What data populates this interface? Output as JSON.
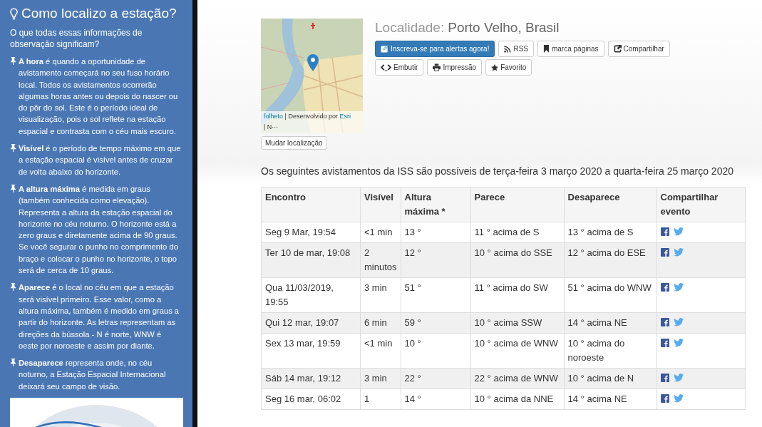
{
  "sidebar": {
    "title": "Como localizo a estação?",
    "intro": "O que todas essas informações de observação significam?",
    "items": [
      {
        "text": "**A hora**  é quando a oportunidade de avistamento começará no seu fuso horário local. Todos os avistamentos ocorrerão algumas horas antes ou depois do nascer ou do pôr do sol. Este é o período ideal de visualização, pois o sol reflete na estação espacial e contrasta com o céu mais escuro."
      },
      {
        "text": "**Visível**  é o período de tempo máximo em que a estação espacial é visível antes de cruzar de volta abaixo do horizonte."
      },
      {
        "text": "**A altura máxima**  é medida em graus (também conhecida como elevação). Representa a altura da estação espacial do horizonte no céu noturno. O horizonte está a zero graus e diretamente acima de 90 graus. Se você segurar o punho no comprimento do braço e colocar o punho no horizonte, o topo será de cerca de 10 graus."
      },
      {
        "text": "**Aparece** é o local no céu em que a estação será visível primeiro. Esse valor, como a altura máxima, também é medido em graus a partir do horizonte. As letras representam as direções da bússola - N é norte, WNW é oeste por noroeste e assim por diante."
      },
      {
        "text": "**Desaparece** representa onde, no céu noturno, a Estação Espacial Internacional deixará seu campo de visão."
      }
    ]
  },
  "map": {
    "attribution_link": "folheto",
    "attribution_text": "| Desenvolvido por",
    "provider_link": "Esri",
    "attribution_more": "| N···",
    "change_button": "Mudar localização"
  },
  "location": {
    "label": "Localidade:",
    "value": "Porto Velho, Brasil"
  },
  "buttons": [
    {
      "kind": "subscribe",
      "label": "Inscreva-se para alertas agora!"
    },
    {
      "kind": "rss",
      "label": "RSS"
    },
    {
      "kind": "bookmark",
      "label": "marca páginas"
    },
    {
      "kind": "share",
      "label": "Compartilhar"
    },
    {
      "kind": "embed",
      "label": "Embutir"
    },
    {
      "kind": "print",
      "label": "Impressão"
    },
    {
      "kind": "favorite",
      "label": "Favorito"
    }
  ],
  "summary": "Os seguintes avistamentos da ISS são possíveis de terça-feira 3 março 2020 a quarta-feira 25 março 2020",
  "table": {
    "columns": [
      "Encontro",
      "Visível",
      "Altura máxima *",
      "Parece",
      "Desaparece",
      "Compartilhar evento"
    ],
    "rows": [
      [
        "Seg 9 Mar, 19:54",
        "<1 min",
        "13 °",
        "11 ° acima de S",
        "13 ° acima de S"
      ],
      [
        "Ter 10 de mar, 19:08",
        "2 minutos",
        "12 °",
        "10 ° acima do SSE",
        "12 ° acima do ESE"
      ],
      [
        "Qua 11/03/2019, 19:55",
        "3 min",
        "51 °",
        "11 ° acima do SW",
        "51 ° acima do WNW"
      ],
      [
        "Qui 12 mar, 19:07",
        "6 min",
        "59 °",
        "10 ° acima SSW",
        "14 ° acima NE"
      ],
      [
        "Sex 13 mar, 19:59",
        "<1 min",
        "10 °",
        "10 ° acima de WNW",
        "10 ° acima do noroeste"
      ],
      [
        "Sáb 14 mar, 19:12",
        "3 min",
        "22 °",
        "22 ° acima de WNW",
        "10 ° acima de N"
      ],
      [
        "Seg 16 mar, 06:02",
        "1",
        "14 °",
        "10 ° acima da NNE",
        "14 ° acima NE"
      ]
    ]
  }
}
